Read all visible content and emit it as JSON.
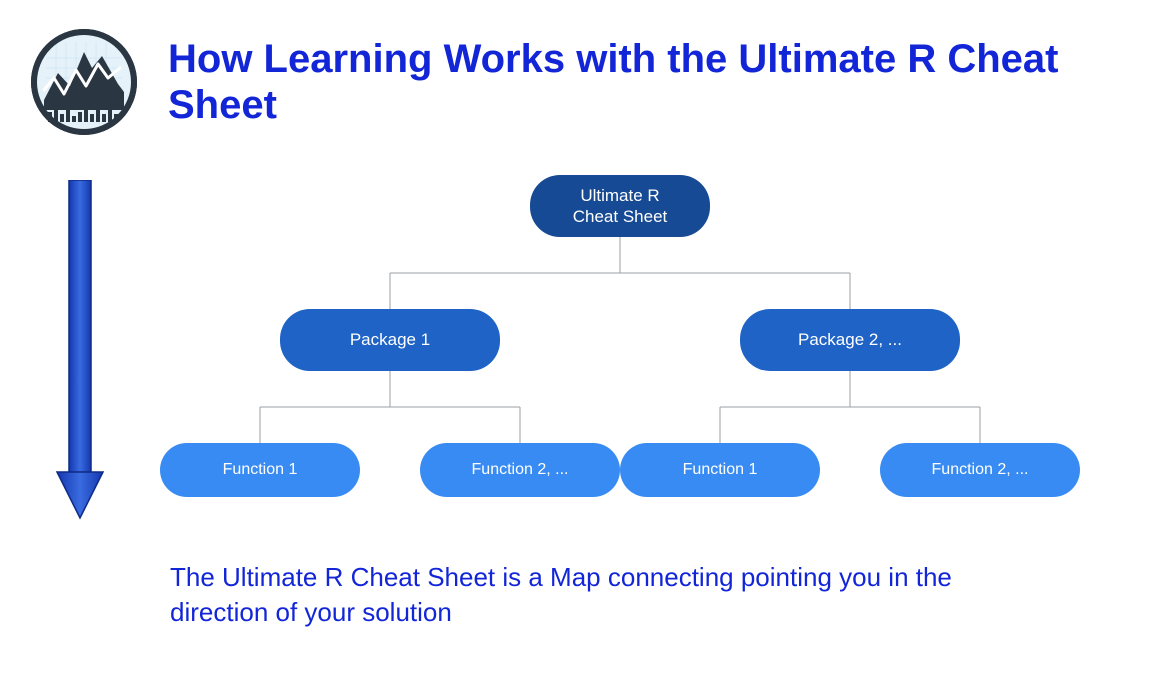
{
  "title": "How Learning Works with the Ultimate R Cheat Sheet",
  "caption": "The Ultimate R Cheat Sheet is a Map connecting pointing you in the direction of your solution",
  "tree": {
    "root": "Ultimate R\nCheat Sheet",
    "level2": [
      "Package 1",
      "Package 2, ..."
    ],
    "level3": [
      "Function 1",
      "Function 2, ...",
      "Function 1",
      "Function 2, ..."
    ]
  },
  "colors": {
    "title": "#1226d8",
    "arrow": "#2b4fc0",
    "root": "#174a94",
    "package": "#1e63c5",
    "function": "#388bf3"
  }
}
